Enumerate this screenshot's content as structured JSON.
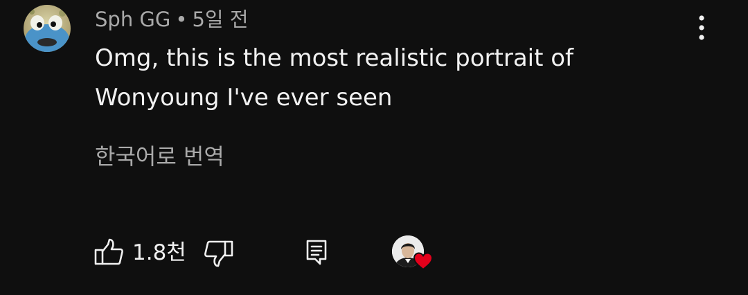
{
  "comment": {
    "author": "Sph GG",
    "separator": "•",
    "time_ago": "5일 전",
    "text_line1": "Omg, this is the most realistic portrait of",
    "text_line2": "Wonyoung I've ever seen",
    "translate_label": "한국어로 번역"
  },
  "actions": {
    "like_count": "1.8천"
  },
  "colors": {
    "background": "#0f0f0f",
    "primary_text": "#f1f1f1",
    "secondary_text": "#aaaaaa",
    "heart": "#e3001b"
  }
}
